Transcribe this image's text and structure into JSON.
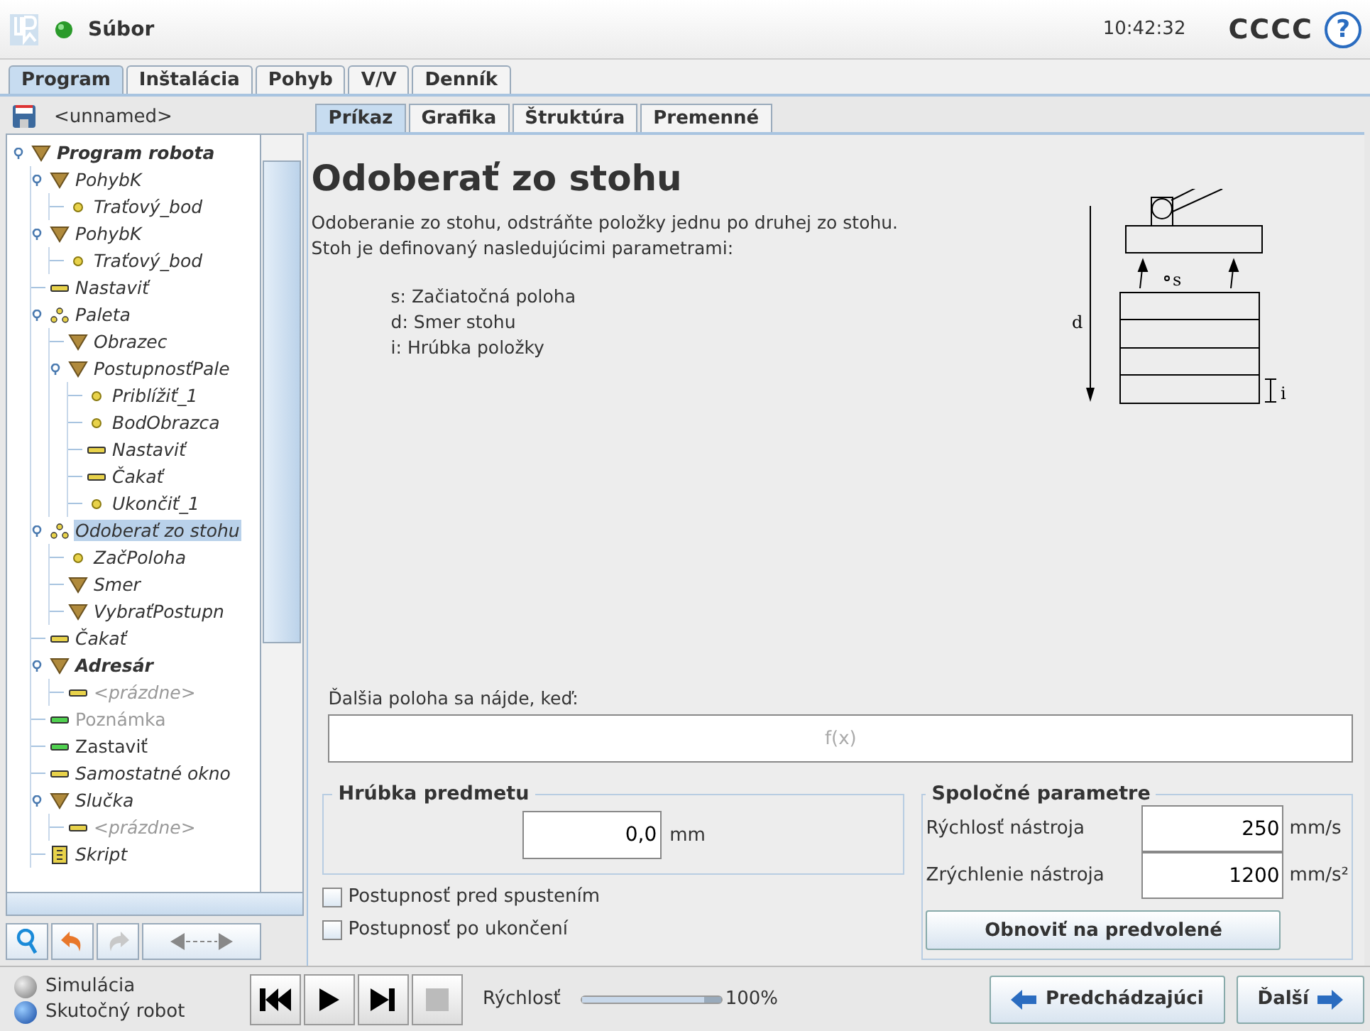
{
  "header": {
    "menu": "Súbor",
    "time": "10:42:32",
    "robot_name": "CCCC",
    "help": "?"
  },
  "tabs": [
    {
      "label": "Program",
      "selected": true
    },
    {
      "label": "Inštalácia",
      "selected": false
    },
    {
      "label": "Pohyb",
      "selected": false
    },
    {
      "label": "V/V",
      "selected": false
    },
    {
      "label": "Denník",
      "selected": false
    }
  ],
  "program_name": "<unnamed>",
  "tree": [
    {
      "label": "Program robota",
      "kind": "folder",
      "bold": true,
      "italic": true,
      "disabled": false,
      "selected": false,
      "children": [
        {
          "label": "PohybK",
          "kind": "folder",
          "bold": false,
          "italic": true,
          "disabled": false,
          "selected": false,
          "children": [
            {
              "label": "Traťový_bod",
              "kind": "point",
              "bold": false,
              "italic": true,
              "disabled": false,
              "selected": false
            }
          ]
        },
        {
          "label": "PohybK",
          "kind": "folder",
          "bold": false,
          "italic": true,
          "disabled": false,
          "selected": false,
          "children": [
            {
              "label": "Traťový_bod",
              "kind": "point",
              "bold": false,
              "italic": true,
              "disabled": false,
              "selected": false
            }
          ]
        },
        {
          "label": "Nastaviť",
          "kind": "command",
          "bold": false,
          "italic": true,
          "disabled": false,
          "selected": false
        },
        {
          "label": "Paleta",
          "kind": "pattern",
          "bold": false,
          "italic": true,
          "disabled": false,
          "selected": false,
          "children": [
            {
              "label": "Obrazec",
              "kind": "folder",
              "bold": false,
              "italic": true,
              "disabled": false,
              "selected": false
            },
            {
              "label": "PostupnosťPale",
              "kind": "folder",
              "bold": false,
              "italic": true,
              "disabled": false,
              "selected": false,
              "children": [
                {
                  "label": "Priblížiť_1",
                  "kind": "point",
                  "bold": false,
                  "italic": true,
                  "disabled": false,
                  "selected": false
                },
                {
                  "label": "BodObrazca",
                  "kind": "point",
                  "bold": false,
                  "italic": true,
                  "disabled": false,
                  "selected": false
                },
                {
                  "label": "Nastaviť",
                  "kind": "command",
                  "bold": false,
                  "italic": true,
                  "disabled": false,
                  "selected": false
                },
                {
                  "label": "Čakať",
                  "kind": "command",
                  "bold": false,
                  "italic": true,
                  "disabled": false,
                  "selected": false
                },
                {
                  "label": "Ukončiť_1",
                  "kind": "point",
                  "bold": false,
                  "italic": true,
                  "disabled": false,
                  "selected": false
                }
              ]
            }
          ]
        },
        {
          "label": "Odoberať zo stohu",
          "kind": "pattern",
          "bold": false,
          "italic": true,
          "disabled": false,
          "selected": true,
          "children": [
            {
              "label": "ZačPoloha",
              "kind": "point",
              "bold": false,
              "italic": true,
              "disabled": false,
              "selected": false
            },
            {
              "label": "Smer",
              "kind": "folder",
              "bold": false,
              "italic": true,
              "disabled": false,
              "selected": false
            },
            {
              "label": "VybraťPostupn",
              "kind": "folder",
              "bold": false,
              "italic": true,
              "disabled": false,
              "selected": false
            }
          ]
        },
        {
          "label": "Čakať",
          "kind": "command",
          "bold": false,
          "italic": true,
          "disabled": false,
          "selected": false
        },
        {
          "label": "Adresár",
          "kind": "folder",
          "bold": true,
          "italic": true,
          "disabled": false,
          "selected": false,
          "children": [
            {
              "label": "<prázdne>",
              "kind": "command",
              "bold": false,
              "italic": true,
              "disabled": true,
              "selected": false
            }
          ]
        },
        {
          "label": "Poznámka",
          "kind": "green",
          "bold": false,
          "italic": false,
          "disabled": true,
          "selected": false
        },
        {
          "label": "Zastaviť",
          "kind": "green",
          "bold": false,
          "italic": false,
          "disabled": false,
          "selected": false
        },
        {
          "label": "Samostatné okno",
          "kind": "command",
          "bold": false,
          "italic": true,
          "disabled": false,
          "selected": false
        },
        {
          "label": "Slučka",
          "kind": "folder",
          "bold": false,
          "italic": true,
          "disabled": false,
          "selected": false,
          "children": [
            {
              "label": "<prázdne>",
              "kind": "command",
              "bold": false,
              "italic": true,
              "disabled": true,
              "selected": false
            }
          ]
        },
        {
          "label": "Skript",
          "kind": "script",
          "bold": false,
          "italic": true,
          "disabled": false,
          "selected": false
        }
      ]
    }
  ],
  "subtabs": [
    {
      "label": "Príkaz",
      "selected": true
    },
    {
      "label": "Grafika",
      "selected": false
    },
    {
      "label": "Štruktúra",
      "selected": false
    },
    {
      "label": "Premenné",
      "selected": false
    }
  ],
  "title": "Odoberať zo stohu",
  "description": [
    "Odoberanie zo stohu, odstráňte položky jednu po druhej zo stohu.",
    "Stoh je definovaný nasledujúcimi parametrami:"
  ],
  "parameters": [
    "s: Začiatočná poloha",
    "d: Smer stohu",
    "i: Hrúbka položky"
  ],
  "diagram_labels": {
    "direction": "d",
    "start": "s",
    "thickness": "i"
  },
  "expression": {
    "label": "Ďalšia poloha sa nájde, keď:",
    "placeholder": "f(x)"
  },
  "thickness_group": {
    "title": "Hrúbka predmetu",
    "value": "0,0",
    "unit": "mm"
  },
  "options": [
    {
      "label": "Postupnosť pred spustením",
      "checked": false
    },
    {
      "label": "Postupnosť po ukončení",
      "checked": false
    }
  ],
  "common_group": {
    "title": "Spoločné parametre",
    "rows": [
      {
        "label": "Rýchlosť nástroja",
        "value": "250",
        "unit": "mm/s"
      },
      {
        "label": "Zrýchlenie nástroja",
        "value": "1200",
        "unit": "mm/s²"
      }
    ],
    "button": "Obnoviť na predvolené"
  },
  "modes": [
    {
      "label": "Simulácia",
      "selected": false
    },
    {
      "label": "Skutočný robot",
      "selected": true
    }
  ],
  "player": {
    "stop_disabled": true
  },
  "speed": {
    "label": "Rýchlosť",
    "level": 1,
    "reading": "100%"
  },
  "nav": {
    "previous": "Predchádzajúci",
    "next": "Ďalší"
  }
}
